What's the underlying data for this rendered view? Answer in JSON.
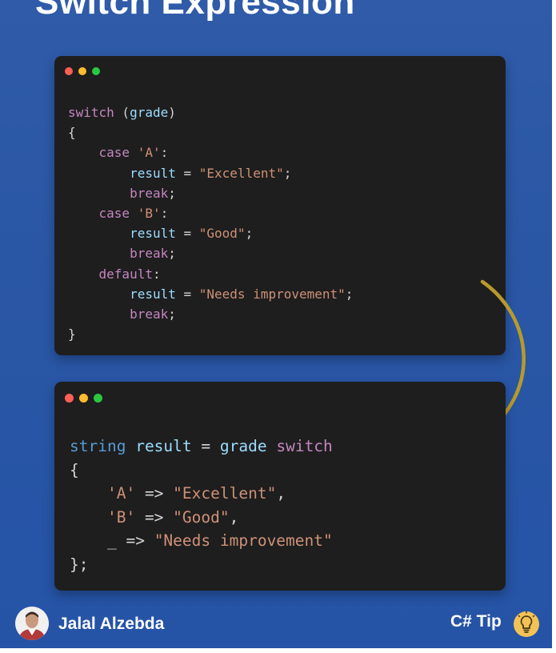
{
  "title": "Switch Expression",
  "before_code": {
    "lines": [
      [
        {
          "c": "kw",
          "t": "switch"
        },
        {
          "c": "punc",
          "t": " ("
        },
        {
          "c": "id",
          "t": "grade"
        },
        {
          "c": "punc",
          "t": ")"
        }
      ],
      [
        {
          "c": "punc",
          "t": "{"
        }
      ],
      [
        {
          "c": "punc",
          "t": "    "
        },
        {
          "c": "kw",
          "t": "case"
        },
        {
          "c": "punc",
          "t": " "
        },
        {
          "c": "str",
          "t": "'A'"
        },
        {
          "c": "punc",
          "t": ":"
        }
      ],
      [
        {
          "c": "punc",
          "t": "        "
        },
        {
          "c": "id",
          "t": "result"
        },
        {
          "c": "punc",
          "t": " = "
        },
        {
          "c": "str",
          "t": "\"Excellent\""
        },
        {
          "c": "punc",
          "t": ";"
        }
      ],
      [
        {
          "c": "punc",
          "t": "        "
        },
        {
          "c": "kw",
          "t": "break"
        },
        {
          "c": "punc",
          "t": ";"
        }
      ],
      [
        {
          "c": "punc",
          "t": "    "
        },
        {
          "c": "kw",
          "t": "case"
        },
        {
          "c": "punc",
          "t": " "
        },
        {
          "c": "str",
          "t": "'B'"
        },
        {
          "c": "punc",
          "t": ":"
        }
      ],
      [
        {
          "c": "punc",
          "t": "        "
        },
        {
          "c": "id",
          "t": "result"
        },
        {
          "c": "punc",
          "t": " = "
        },
        {
          "c": "str",
          "t": "\"Good\""
        },
        {
          "c": "punc",
          "t": ";"
        }
      ],
      [
        {
          "c": "punc",
          "t": "        "
        },
        {
          "c": "kw",
          "t": "break"
        },
        {
          "c": "punc",
          "t": ";"
        }
      ],
      [
        {
          "c": "punc",
          "t": "    "
        },
        {
          "c": "kw",
          "t": "default"
        },
        {
          "c": "punc",
          "t": ":"
        }
      ],
      [
        {
          "c": "punc",
          "t": "        "
        },
        {
          "c": "id",
          "t": "result"
        },
        {
          "c": "punc",
          "t": " = "
        },
        {
          "c": "str",
          "t": "\"Needs improvement\""
        },
        {
          "c": "punc",
          "t": ";"
        }
      ],
      [
        {
          "c": "punc",
          "t": "        "
        },
        {
          "c": "kw",
          "t": "break"
        },
        {
          "c": "punc",
          "t": ";"
        }
      ],
      [
        {
          "c": "punc",
          "t": "}"
        }
      ]
    ]
  },
  "after_code": {
    "lines": [
      [
        {
          "c": "ty",
          "t": "string"
        },
        {
          "c": "punc",
          "t": " "
        },
        {
          "c": "id",
          "t": "result"
        },
        {
          "c": "punc",
          "t": " = "
        },
        {
          "c": "id",
          "t": "grade"
        },
        {
          "c": "punc",
          "t": " "
        },
        {
          "c": "kw",
          "t": "switch"
        }
      ],
      [
        {
          "c": "punc",
          "t": "{"
        }
      ],
      [
        {
          "c": "punc",
          "t": "    "
        },
        {
          "c": "str",
          "t": "'A'"
        },
        {
          "c": "punc",
          "t": " => "
        },
        {
          "c": "str",
          "t": "\"Excellent\""
        },
        {
          "c": "punc",
          "t": ","
        }
      ],
      [
        {
          "c": "punc",
          "t": "    "
        },
        {
          "c": "str",
          "t": "'B'"
        },
        {
          "c": "punc",
          "t": " => "
        },
        {
          "c": "str",
          "t": "\"Good\""
        },
        {
          "c": "punc",
          "t": ","
        }
      ],
      [
        {
          "c": "punc",
          "t": "    "
        },
        {
          "c": "punc",
          "t": "_"
        },
        {
          "c": "punc",
          "t": " => "
        },
        {
          "c": "str",
          "t": "\"Needs improvement\""
        }
      ],
      [
        {
          "c": "punc",
          "t": "};"
        }
      ]
    ]
  },
  "footer": {
    "author": "Jalal Alzebda",
    "tag": "C# Tip"
  },
  "icons": {
    "avatar": "author-avatar",
    "bulb": "lightbulb-icon",
    "arrow": "curved-arrow-icon"
  },
  "colors": {
    "background": "#2a57a5",
    "code_bg": "#1e1e1e",
    "keyword": "#c586c0",
    "identifier": "#9cdcfe",
    "string": "#ce9178",
    "type": "#569cd6",
    "arrow": "#b89a2a"
  }
}
